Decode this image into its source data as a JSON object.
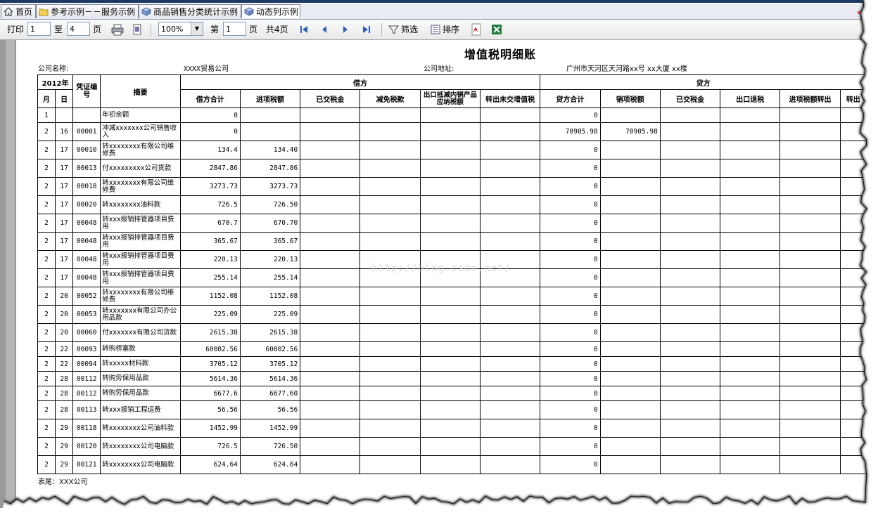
{
  "tabs": [
    {
      "label": "首页",
      "icon": "home-icon"
    },
    {
      "label": "参考示例－－服务示例",
      "icon": "folder-icon"
    },
    {
      "label": "商品销售分类统计示例",
      "icon": "cube-icon"
    },
    {
      "label": "动态列示例",
      "icon": "cube-icon"
    }
  ],
  "toolbar": {
    "print_label": "打印",
    "from_value": "1",
    "to_label": "至",
    "to_value": "4",
    "page_label": "页",
    "zoom_value": "100%",
    "di_label": "第",
    "current_page": "1",
    "page_label2": "页",
    "total_pages": "共4页",
    "filter_label": "筛选",
    "sort_label": "排序"
  },
  "report": {
    "title": "增值税明细账",
    "company_name_label": "公司名称:",
    "company_name": "XXXX贸易公司",
    "company_addr_label": "公司地址:",
    "company_addr": "广州市天河区天河路xx号 xx大厦 xx楼",
    "footer": "表尾：XXX公司",
    "watermark": "http://blog.csdn.net/"
  },
  "table": {
    "year_header": "2012年",
    "month_header": "月",
    "day_header": "日",
    "voucher_header": "凭证编号",
    "summary_header": "摘要",
    "debit_group": "借方",
    "credit_group": "贷方",
    "debit_cols": [
      "借方合计",
      "进项税额",
      "已交税金",
      "减免税款",
      "出口抵减内销产品应纳税额",
      "转出未交增值税"
    ],
    "credit_cols": [
      "贷方合计",
      "销项税额",
      "已交税金",
      "出口退税",
      "进项税额转出",
      "转出"
    ],
    "rows": [
      {
        "m": "1",
        "d": "",
        "v": "",
        "s": "年初余额",
        "dt": "0",
        "jx": "",
        "ct": "0",
        "xx": ""
      },
      {
        "m": "2",
        "d": "16",
        "v": "00001",
        "s": "冲减xxxxxxx公司销售收入",
        "dt": "0",
        "jx": "",
        "ct": "70905.98",
        "xx": "70905.98"
      },
      {
        "m": "2",
        "d": "17",
        "v": "00010",
        "s": "转xxxxxxxx有限公司维修费",
        "dt": "134.4",
        "jx": "134.40",
        "ct": "0",
        "xx": ""
      },
      {
        "m": "2",
        "d": "17",
        "v": "00013",
        "s": "付xxxxxxxxx公司货款",
        "dt": "2847.86",
        "jx": "2847.86",
        "ct": "0",
        "xx": ""
      },
      {
        "m": "2",
        "d": "17",
        "v": "00018",
        "s": "转xxxxxxxx有限公司维修费",
        "dt": "3273.73",
        "jx": "3273.73",
        "ct": "0",
        "xx": ""
      },
      {
        "m": "2",
        "d": "17",
        "v": "00020",
        "s": "转xxxxxxxx油料款",
        "dt": "726.5",
        "jx": "726.50",
        "ct": "0",
        "xx": ""
      },
      {
        "m": "2",
        "d": "17",
        "v": "00048",
        "s": "转xxx报销排管器项目费用",
        "dt": "670.7",
        "jx": "670.70",
        "ct": "0",
        "xx": ""
      },
      {
        "m": "2",
        "d": "17",
        "v": "00048",
        "s": "转xxx报销排管器项目费用",
        "dt": "365.67",
        "jx": "365.67",
        "ct": "0",
        "xx": ""
      },
      {
        "m": "2",
        "d": "17",
        "v": "00048",
        "s": "转xxx报销排管器项目费用",
        "dt": "220.13",
        "jx": "220.13",
        "ct": "0",
        "xx": ""
      },
      {
        "m": "2",
        "d": "17",
        "v": "00048",
        "s": "转xxx报销排管器项目费用",
        "dt": "255.14",
        "jx": "255.14",
        "ct": "0",
        "xx": ""
      },
      {
        "m": "2",
        "d": "20",
        "v": "00052",
        "s": "转xxxxxxxx有限公司维修费",
        "dt": "1152.08",
        "jx": "1152.08",
        "ct": "0",
        "xx": ""
      },
      {
        "m": "2",
        "d": "20",
        "v": "00053",
        "s": "转xxxxxxx有限公司办公用品款",
        "dt": "225.09",
        "jx": "225.09",
        "ct": "0",
        "xx": ""
      },
      {
        "m": "2",
        "d": "20",
        "v": "00060",
        "s": "付xxxxxxx有限公司货款",
        "dt": "2615.38",
        "jx": "2615.38",
        "ct": "0",
        "xx": ""
      },
      {
        "m": "2",
        "d": "22",
        "v": "00093",
        "s": "转购桥塞款",
        "dt": "60002.56",
        "jx": "60002.56",
        "ct": "0",
        "xx": ""
      },
      {
        "m": "2",
        "d": "22",
        "v": "00094",
        "s": "转xxxxx材料款",
        "dt": "3705.12",
        "jx": "3705.12",
        "ct": "0",
        "xx": ""
      },
      {
        "m": "2",
        "d": "28",
        "v": "00112",
        "s": "转购劳保用品款",
        "dt": "5614.36",
        "jx": "5614.36",
        "ct": "0",
        "xx": ""
      },
      {
        "m": "2",
        "d": "28",
        "v": "00112",
        "s": "转购劳保用品款",
        "dt": "6677.6",
        "jx": "6677.60",
        "ct": "0",
        "xx": ""
      },
      {
        "m": "2",
        "d": "28",
        "v": "00113",
        "s": "转xxx报销工程运费",
        "dt": "56.56",
        "jx": "56.56",
        "ct": "0",
        "xx": ""
      },
      {
        "m": "2",
        "d": "29",
        "v": "00118",
        "s": "转xxxxxxxx公司油料款",
        "dt": "1452.99",
        "jx": "1452.99",
        "ct": "0",
        "xx": ""
      },
      {
        "m": "2",
        "d": "29",
        "v": "00120",
        "s": "转xxxxxxxx公司电脑款",
        "dt": "726.5",
        "jx": "726.50",
        "ct": "0",
        "xx": ""
      },
      {
        "m": "2",
        "d": "29",
        "v": "00121",
        "s": "转xxxxxxxx公司电脑款",
        "dt": "624.64",
        "jx": "624.64",
        "ct": "0",
        "xx": ""
      }
    ]
  }
}
